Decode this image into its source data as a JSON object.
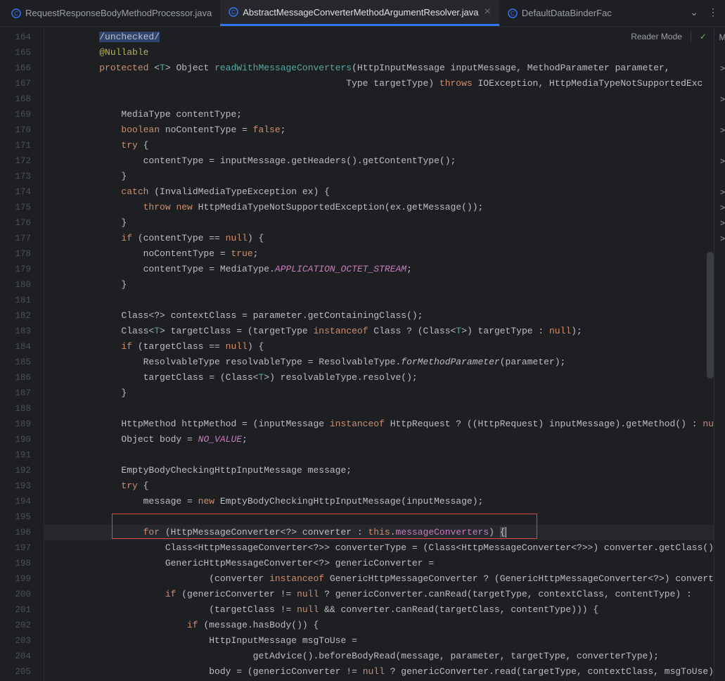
{
  "tabs": [
    {
      "label": "RequestResponseBodyMethodProcessor.java",
      "active": false,
      "closable": false
    },
    {
      "label": "AbstractMessageConverterMethodArgumentResolver.java",
      "active": true,
      "closable": true
    },
    {
      "label": "DefaultDataBinderFac",
      "active": false,
      "closable": false
    }
  ],
  "readerMode": "Reader Mode",
  "gutterStart": 164,
  "gutterEnd": 205,
  "rightGutterLetters": [
    "M",
    "",
    ">",
    "",
    ">",
    "",
    ">",
    "",
    ">",
    "",
    ">",
    ">",
    ">",
    ">"
  ],
  "code": [
    {
      "segs": [
        [
          "",
          "         "
        ],
        [
          "c-tag",
          "/unchecked/"
        ]
      ]
    },
    {
      "segs": [
        [
          "",
          "         "
        ],
        [
          "c-ann",
          "@Nullable"
        ]
      ]
    },
    {
      "segs": [
        [
          "",
          "         "
        ],
        [
          "c-kw",
          "protected"
        ],
        [
          "",
          " <"
        ],
        [
          "c-gen",
          "T"
        ],
        [
          "",
          "> Object "
        ],
        [
          "c-fn",
          "readWithMessageConverters"
        ],
        [
          "",
          "(HttpInputMessage inputMessage, MethodParameter parameter,"
        ]
      ]
    },
    {
      "segs": [
        [
          "",
          "                                                      Type targetType) "
        ],
        [
          "c-kw",
          "throws"
        ],
        [
          "",
          " IOException, HttpMediaTypeNotSupportedExc"
        ]
      ]
    },
    {
      "segs": [
        [
          "",
          ""
        ]
      ]
    },
    {
      "segs": [
        [
          "",
          "             MediaType contentType;"
        ]
      ]
    },
    {
      "segs": [
        [
          "",
          "             "
        ],
        [
          "c-kw",
          "boolean"
        ],
        [
          "",
          " noContentType = "
        ],
        [
          "c-kw",
          "false"
        ],
        [
          "",
          ";"
        ]
      ]
    },
    {
      "segs": [
        [
          "",
          "             "
        ],
        [
          "c-kw",
          "try"
        ],
        [
          "",
          " {"
        ]
      ]
    },
    {
      "segs": [
        [
          "",
          "                 contentType = inputMessage.getHeaders().getContentType();"
        ]
      ]
    },
    {
      "segs": [
        [
          "",
          "             }"
        ]
      ]
    },
    {
      "segs": [
        [
          "",
          "             "
        ],
        [
          "c-kw",
          "catch"
        ],
        [
          "",
          " (InvalidMediaTypeException ex) {"
        ]
      ]
    },
    {
      "segs": [
        [
          "",
          "                 "
        ],
        [
          "c-kw",
          "throw"
        ],
        [
          "",
          " "
        ],
        [
          "c-kw",
          "new"
        ],
        [
          "",
          " HttpMediaTypeNotSupportedException(ex.getMessage());"
        ]
      ]
    },
    {
      "segs": [
        [
          "",
          "             }"
        ]
      ]
    },
    {
      "segs": [
        [
          "",
          "             "
        ],
        [
          "c-kw",
          "if"
        ],
        [
          "",
          " (contentType == "
        ],
        [
          "c-kw",
          "null"
        ],
        [
          "",
          ") {"
        ]
      ]
    },
    {
      "segs": [
        [
          "",
          "                 noContentType = "
        ],
        [
          "c-kw",
          "true"
        ],
        [
          "",
          ";"
        ]
      ]
    },
    {
      "segs": [
        [
          "",
          "                 contentType = MediaType."
        ],
        [
          "c-sfld",
          "APPLICATION_OCTET_STREAM"
        ],
        [
          "",
          ";"
        ]
      ]
    },
    {
      "segs": [
        [
          "",
          "             }"
        ]
      ]
    },
    {
      "segs": [
        [
          "",
          ""
        ]
      ]
    },
    {
      "segs": [
        [
          "",
          "             Class<?> contextClass = parameter.getContainingClass();"
        ]
      ]
    },
    {
      "segs": [
        [
          "",
          "             Class<"
        ],
        [
          "c-gen",
          "T"
        ],
        [
          "",
          "> targetClass = (targetType "
        ],
        [
          "c-kw",
          "instanceof"
        ],
        [
          "",
          " Class ? (Class<"
        ],
        [
          "c-gen",
          "T"
        ],
        [
          "",
          ">) targetType : "
        ],
        [
          "c-kw",
          "null"
        ],
        [
          "",
          ");"
        ]
      ]
    },
    {
      "segs": [
        [
          "",
          "             "
        ],
        [
          "c-kw",
          "if"
        ],
        [
          "",
          " (targetClass == "
        ],
        [
          "c-kw",
          "null"
        ],
        [
          "",
          ") {"
        ]
      ]
    },
    {
      "segs": [
        [
          "",
          "                 ResolvableType resolvableType = ResolvableType."
        ],
        [
          "c-fni",
          "forMethodParameter"
        ],
        [
          "",
          "(parameter);"
        ]
      ]
    },
    {
      "segs": [
        [
          "",
          "                 targetClass = (Class<"
        ],
        [
          "c-gen",
          "T"
        ],
        [
          "",
          ">) resolvableType.resolve();"
        ]
      ]
    },
    {
      "segs": [
        [
          "",
          "             }"
        ]
      ]
    },
    {
      "segs": [
        [
          "",
          ""
        ]
      ]
    },
    {
      "segs": [
        [
          "",
          "             HttpMethod httpMethod = (inputMessage "
        ],
        [
          "c-kw",
          "instanceof"
        ],
        [
          "",
          " HttpRequest ? ((HttpRequest) inputMessage).getMethod() : "
        ],
        [
          "c-kw",
          "nu"
        ]
      ]
    },
    {
      "segs": [
        [
          "",
          "             Object body = "
        ],
        [
          "c-sfld",
          "NO_VALUE"
        ],
        [
          "",
          ";"
        ]
      ]
    },
    {
      "segs": [
        [
          "",
          ""
        ]
      ]
    },
    {
      "segs": [
        [
          "",
          "             EmptyBodyCheckingHttpInputMessage message;"
        ]
      ]
    },
    {
      "segs": [
        [
          "",
          "             "
        ],
        [
          "c-kw",
          "try"
        ],
        [
          "",
          " {"
        ]
      ]
    },
    {
      "segs": [
        [
          "",
          "                 message = "
        ],
        [
          "c-kw",
          "new"
        ],
        [
          "",
          " EmptyBodyCheckingHttpInputMessage(inputMessage);"
        ]
      ]
    },
    {
      "segs": [
        [
          "",
          ""
        ]
      ]
    },
    {
      "segs": [
        [
          "",
          "                 "
        ],
        [
          "c-kw",
          "for"
        ],
        [
          "",
          " (HttpMessageConverter<?> converter : "
        ],
        [
          "c-kw",
          "this"
        ],
        [
          "",
          "."
        ],
        [
          "c-fld",
          "messageConverters"
        ],
        [
          "",
          ") "
        ],
        [
          "c-bracket",
          "{"
        ],
        [
          "c-caret",
          ""
        ]
      ],
      "current": true
    },
    {
      "segs": [
        [
          "",
          "                     Class<HttpMessageConverter<?>> converterType = (Class<HttpMessageConverter<?>>) converter.getClass()"
        ]
      ]
    },
    {
      "segs": [
        [
          "",
          "                     GenericHttpMessageConverter<?> genericConverter ="
        ]
      ]
    },
    {
      "segs": [
        [
          "",
          "                             (converter "
        ],
        [
          "c-kw",
          "instanceof"
        ],
        [
          "",
          " GenericHttpMessageConverter ? (GenericHttpMessageConverter<?>) convert"
        ]
      ]
    },
    {
      "segs": [
        [
          "",
          "                     "
        ],
        [
          "c-kw",
          "if"
        ],
        [
          "",
          " (genericConverter != "
        ],
        [
          "c-kw",
          "null"
        ],
        [
          "",
          " ? genericConverter.canRead(targetType, contextClass, contentType) :"
        ]
      ]
    },
    {
      "segs": [
        [
          "",
          "                             (targetClass != "
        ],
        [
          "c-kw",
          "null"
        ],
        [
          "",
          " && converter.canRead(targetClass, contentType))) {"
        ]
      ]
    },
    {
      "segs": [
        [
          "",
          "                         "
        ],
        [
          "c-kw",
          "if"
        ],
        [
          "",
          " (message.hasBody()) {"
        ]
      ]
    },
    {
      "segs": [
        [
          "",
          "                             HttpInputMessage msgToUse ="
        ]
      ]
    },
    {
      "segs": [
        [
          "",
          "                                     getAdvice().beforeBodyRead(message, parameter, targetType, converterType);"
        ]
      ]
    },
    {
      "segs": [
        [
          "",
          "                             body = (genericConverter != "
        ],
        [
          "c-kw",
          "null"
        ],
        [
          "",
          " ? genericConverter.read(targetType, contextClass, msgToUse)"
        ]
      ]
    }
  ]
}
